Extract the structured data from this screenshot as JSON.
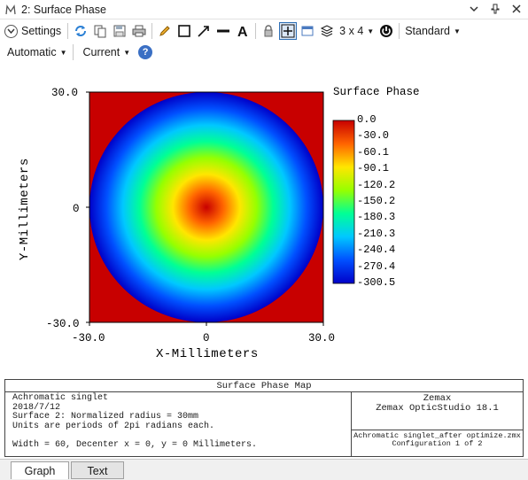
{
  "window": {
    "title": "2: Surface Phase",
    "icon": "zemax-analysis-icon",
    "controls": [
      "chevron-down-icon",
      "pin-icon",
      "close-icon"
    ]
  },
  "toolbar": {
    "settings_label": "Settings",
    "icons": [
      "refresh-icon",
      "copy-icon",
      "save-icon",
      "print-icon",
      "pencil-icon",
      "rectangle-icon",
      "arrow-icon",
      "line-icon",
      "text-icon",
      "lock-icon",
      "zoom-fit-icon",
      "window-icon",
      "layers-icon"
    ],
    "layout_value": "3 x 4",
    "style_value": "Standard",
    "scale_value": "Automatic",
    "config_value": "Current"
  },
  "chart_data": {
    "type": "heatmap",
    "title": "Surface Phase",
    "xlabel": "X-Millimeters",
    "ylabel": "Y-Millimeters",
    "x_ticks": [
      "-30.0",
      "0",
      "30.0"
    ],
    "y_ticks": [
      "30.0",
      "0",
      "-30.0"
    ],
    "xlim": [
      -30,
      30
    ],
    "ylim": [
      -30,
      30
    ],
    "colorbar_labels": [
      "0.0",
      "-30.0",
      "-60.1",
      "-90.1",
      "-120.2",
      "-150.2",
      "-180.3",
      "-210.3",
      "-240.4",
      "-270.4",
      "-300.5"
    ],
    "range": [
      -300.5,
      0.0
    ],
    "pupil_radius": 30,
    "center_value": 0.0,
    "edge_value": -300.5,
    "outside_value": 0.0,
    "colormap": [
      "#0000c8",
      "#0050ff",
      "#00c8ff",
      "#00ff96",
      "#96ff00",
      "#ffe600",
      "#ff6400",
      "#c80000"
    ]
  },
  "info": {
    "header": "Surface Phase Map",
    "lines": [
      "Achromatic singlet",
      "2018/7/12",
      "Surface 2: Normalized radius = 30mm",
      "Units are periods of 2pi radians each.",
      "",
      "Width = 60, Decenter x = 0, y = 0 Millimeters."
    ],
    "company": "Zemax",
    "product": "Zemax OpticStudio 18.1",
    "filename": "Achromatic singlet_after optimize.zmx",
    "config": "Configuration 1 of 2"
  },
  "tabs": [
    "Graph",
    "Text"
  ]
}
